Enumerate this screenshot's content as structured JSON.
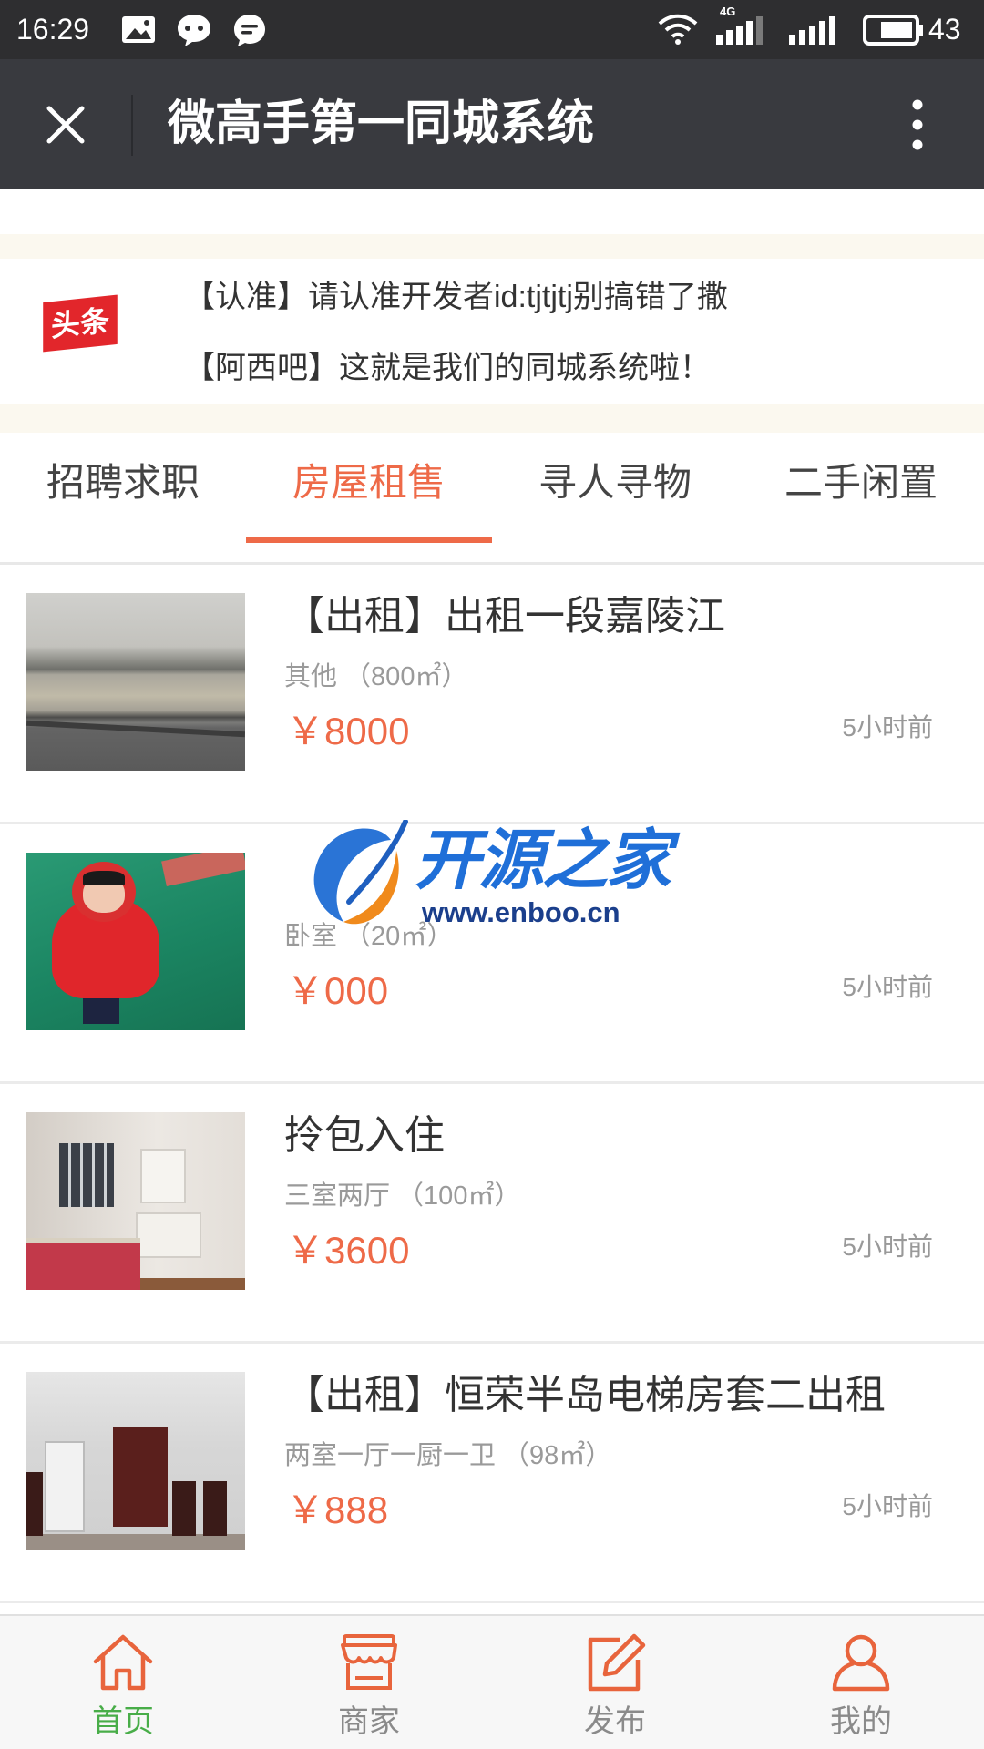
{
  "status_bar": {
    "time": "16:29",
    "network": "4G",
    "battery": "43",
    "left_icons": [
      "gallery-icon",
      "chat-bubble-icon",
      "message-icon"
    ],
    "right_icons": [
      "wifi-icon",
      "signal-4g-icon",
      "signal-icon",
      "battery-icon"
    ]
  },
  "header": {
    "title": "微高手第一同城系统",
    "close_icon": "close-icon",
    "menu_icon": "more-vertical-icon"
  },
  "notice": {
    "badge": "头条",
    "lines": [
      "【认准】请认准开发者id:tjtjtj别搞错了撒",
      "【阿西吧】这就是我们的同城系统啦！"
    ]
  },
  "tabs": [
    {
      "label": "招聘求职",
      "active": false
    },
    {
      "label": "房屋租售",
      "active": true
    },
    {
      "label": "寻人寻物",
      "active": false
    },
    {
      "label": "二手闲置",
      "active": false
    }
  ],
  "listings": [
    {
      "title": "【出租】出租一段嘉陵江",
      "sub": "其他 （800㎡）",
      "price": "￥8000",
      "time": "5小时前"
    },
    {
      "title": "",
      "sub": "卧室 （20㎡）",
      "price": "￥000",
      "time": "5小时前"
    },
    {
      "title": "拎包入住",
      "sub": "三室两厅 （100㎡）",
      "price": "￥3600",
      "time": "5小时前"
    },
    {
      "title": "【出租】恒荣半岛电梯房套二出租",
      "sub": "两室一厅一厨一卫 （98㎡）",
      "price": "￥888",
      "time": "5小时前"
    }
  ],
  "watermark": {
    "name": "开源之家",
    "url": "www.enboo.cn"
  },
  "bottom_nav": [
    {
      "label": "首页",
      "icon": "home-icon",
      "active": true
    },
    {
      "label": "商家",
      "icon": "shop-icon",
      "active": false
    },
    {
      "label": "发布",
      "icon": "edit-icon",
      "active": false
    },
    {
      "label": "我的",
      "icon": "user-icon",
      "active": false
    }
  ],
  "colors": {
    "accent": "#ee6a48",
    "nav_active": "#48ad48",
    "header_bg": "#393a3f",
    "status_bg": "#2e2e30",
    "badge_red": "#e2262b"
  }
}
